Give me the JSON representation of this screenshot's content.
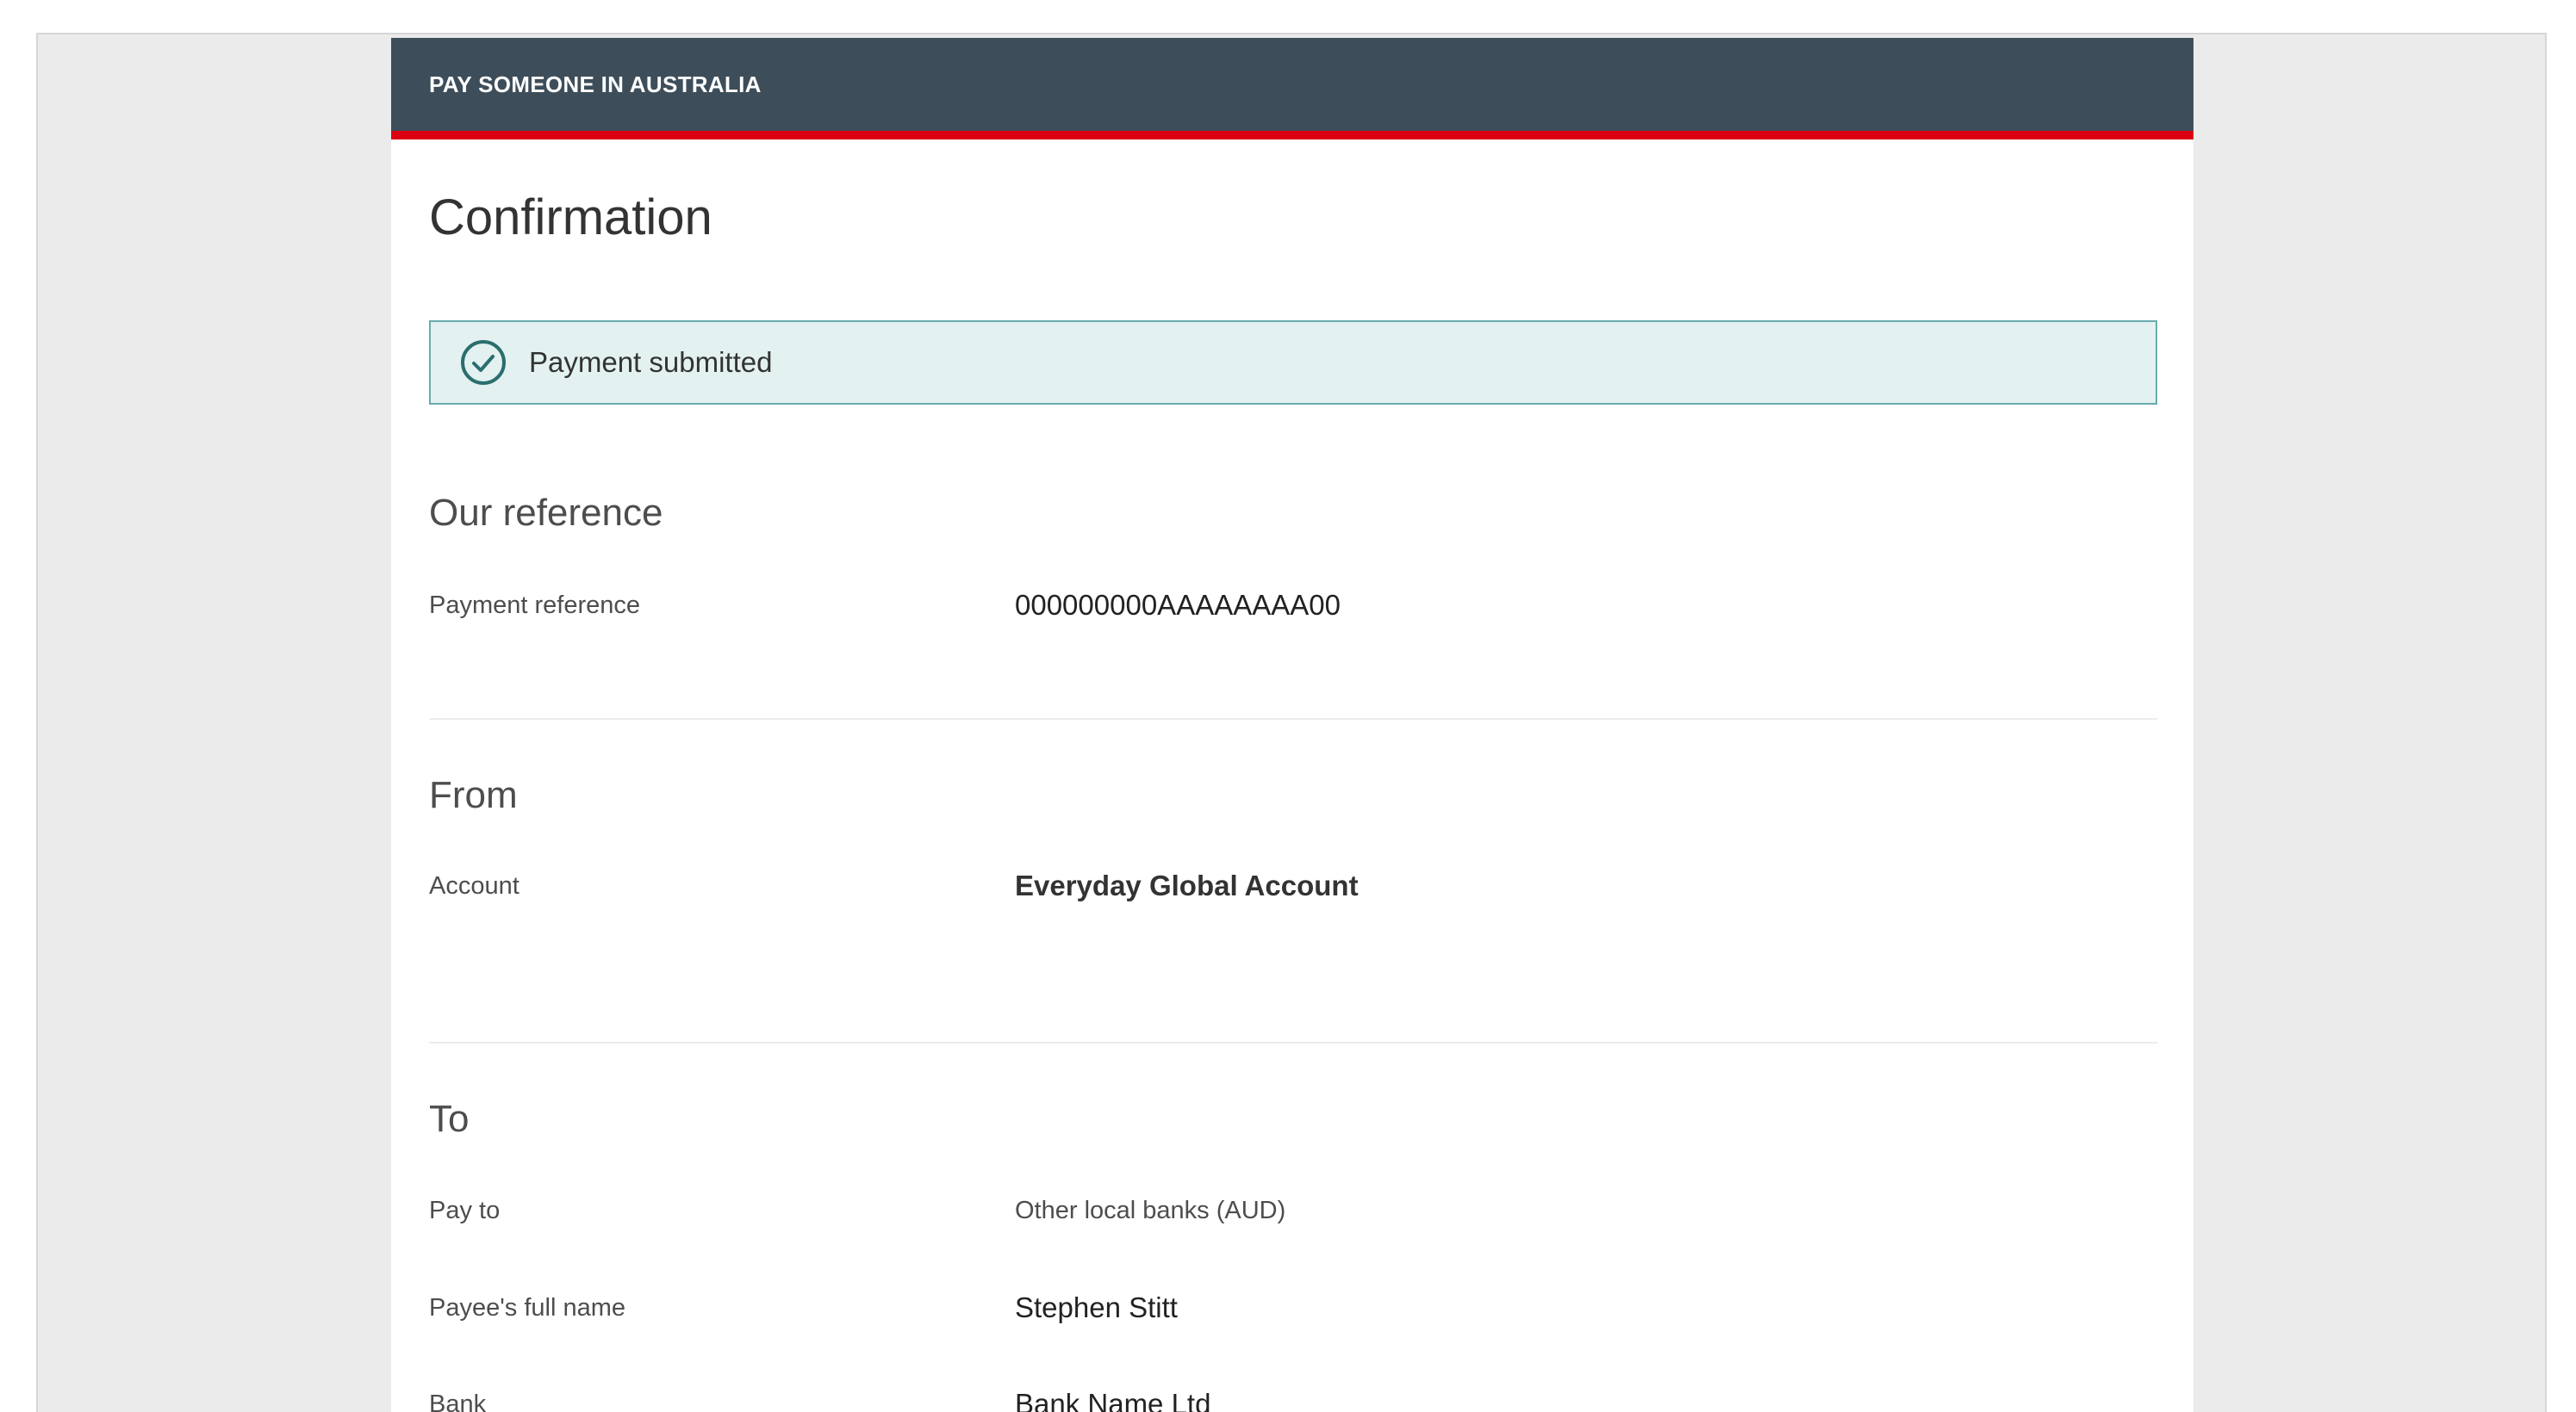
{
  "header": {
    "title": "PAY SOMEONE IN AUSTRALIA"
  },
  "page": {
    "title": "Confirmation"
  },
  "status": {
    "message": "Payment submitted",
    "icon": "check-circle-icon",
    "background_color": "#e3f1f1",
    "border_color": "#6aabae"
  },
  "sections": {
    "reference": {
      "title": "Our reference",
      "payment_reference_label": "Payment reference",
      "payment_reference_value": "000000000AAAAAAAA00"
    },
    "from": {
      "title": "From",
      "account_label": "Account",
      "account_value": "Everyday Global Account"
    },
    "to": {
      "title": "To",
      "pay_to_label": "Pay to",
      "pay_to_value": "Other local banks (AUD)",
      "payee_name_label": "Payee's full name",
      "payee_name_value": "Stephen Stitt",
      "bank_label": "Bank",
      "bank_value": "Bank Name Ltd"
    }
  },
  "colors": {
    "header_bg": "#3d4d5a",
    "accent_red": "#db0011",
    "check_icon": "#2b6e6e"
  }
}
